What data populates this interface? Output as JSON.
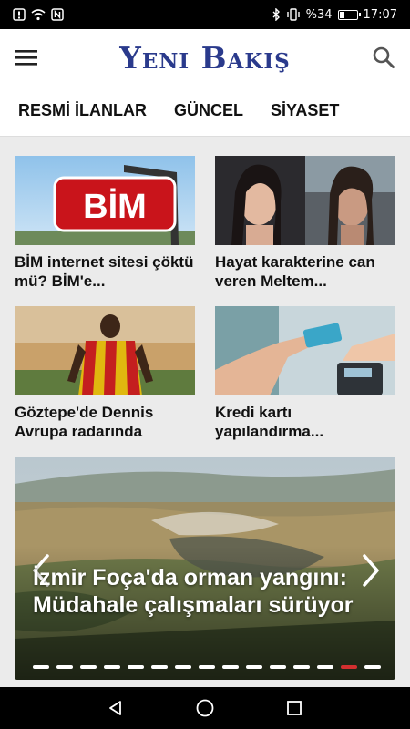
{
  "status_bar": {
    "battery": "%34",
    "battery_level": 0.34,
    "time": "17:07",
    "left_icons": [
      "notification-icon",
      "wifi-icon",
      "nfc-icon"
    ],
    "right_icons": [
      "bluetooth-icon",
      "vibrate-icon",
      "battery-icon"
    ]
  },
  "header": {
    "logo_text": "Yeni Bakış",
    "logo_color": "#2a3a8c",
    "menu_icon": "hamburger-menu-icon",
    "search_icon": "search-icon"
  },
  "nav": {
    "tabs": [
      "RESMİ İLANLAR",
      "GÜNCEL",
      "SİYASET"
    ]
  },
  "cards": [
    {
      "title": "BİM internet sitesi çöktü mü? BİM'e...",
      "image": "bim-sign"
    },
    {
      "title": "Hayat karakterine can veren Meltem...",
      "image": "actress-portraits"
    },
    {
      "title": "Göztepe'de Dennis Avrupa radarında",
      "image": "football-player"
    },
    {
      "title": "Kredi kartı yapılandırma...",
      "image": "credit-card-payment"
    }
  ],
  "slider": {
    "title": "İzmir Foça'da orman yangını: Müdahale çalışmaları sürüyor",
    "dot_count": 15,
    "active_dot": 13,
    "active_color": "#d32f2f"
  },
  "bottom_nav": {
    "icons": [
      "back-icon",
      "home-icon",
      "recents-icon"
    ]
  }
}
